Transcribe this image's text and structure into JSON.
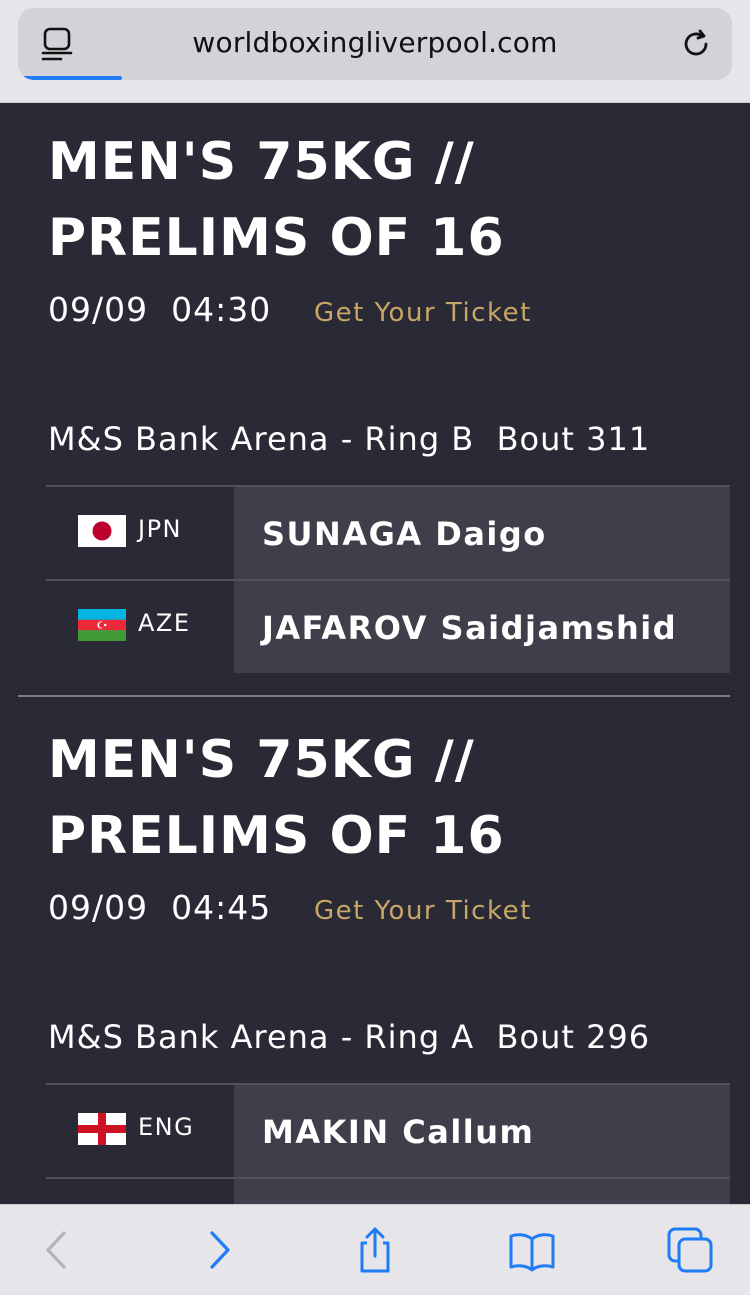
{
  "browser": {
    "url": "worldboxingliverpool.com",
    "reader_icon": "reader-mode-icon",
    "reload_icon": "reload-icon",
    "toolbar_icons": [
      "back-icon",
      "forward-icon",
      "share-icon",
      "bookmarks-icon",
      "tabs-icon"
    ],
    "accent_color": "#1f7cf5"
  },
  "bouts": [
    {
      "title": "MEN'S 75KG // PRELIMS OF 16",
      "date": "09/09",
      "time": "04:30",
      "ticket_label": "Get Your Ticket",
      "venue": "M&S Bank Arena - Ring B",
      "bout_label": "Bout 311",
      "fighters": [
        {
          "country_code": "JPN",
          "flag": "japan-flag",
          "name": "SUNAGA Daigo"
        },
        {
          "country_code": "AZE",
          "flag": "azerbaijan-flag",
          "name": "JAFAROV Saidjamshid"
        }
      ]
    },
    {
      "title": "MEN'S 75KG // PRELIMS OF 16",
      "date": "09/09",
      "time": "04:45",
      "ticket_label": "Get Your Ticket",
      "venue": "M&S Bank Arena - Ring A",
      "bout_label": "Bout 296",
      "fighters": [
        {
          "country_code": "ENG",
          "flag": "england-flag",
          "name": "MAKIN Callum"
        }
      ]
    }
  ],
  "colors": {
    "background": "#2a2a36",
    "name_cell": "#3f3f4b",
    "ticket_link": "#c8a766"
  }
}
